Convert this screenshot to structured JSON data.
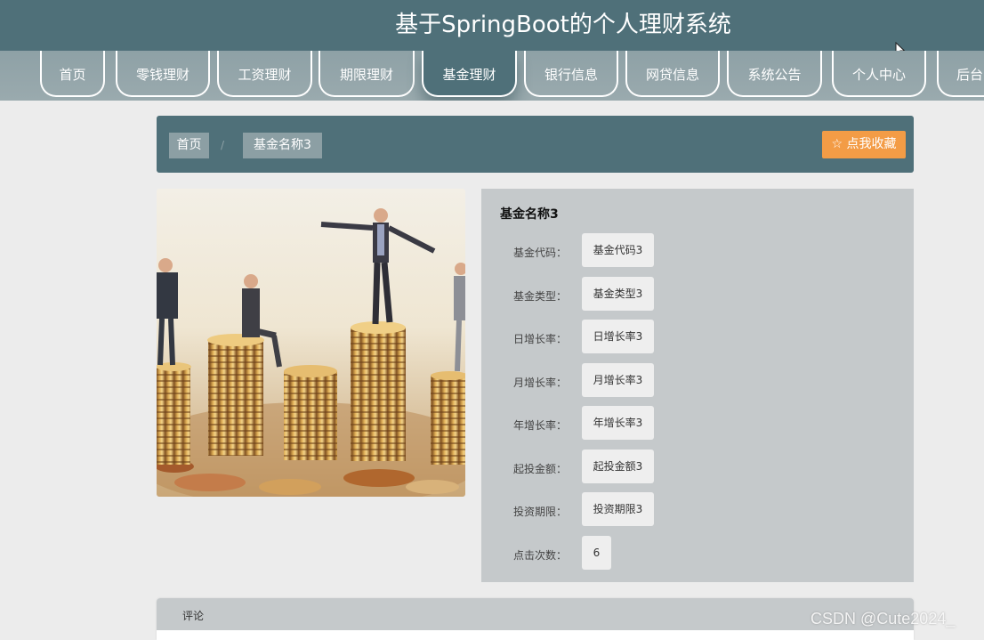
{
  "site": {
    "title": "基于SpringBoot的个人理财系统"
  },
  "nav": {
    "items": [
      {
        "label": "首页"
      },
      {
        "label": "零钱理财"
      },
      {
        "label": "工资理财"
      },
      {
        "label": "期限理财"
      },
      {
        "label": "基金理财",
        "active": true
      },
      {
        "label": "银行信息"
      },
      {
        "label": "网贷信息"
      },
      {
        "label": "系统公告"
      },
      {
        "label": "个人中心"
      },
      {
        "label": "后台"
      }
    ]
  },
  "breadcrumb": {
    "home": "首页",
    "separator": "/",
    "current": "基金名称3"
  },
  "favorite": {
    "label": "☆ 点我收藏"
  },
  "photo": {
    "icon": "fund-photo"
  },
  "details": {
    "title": "基金名称3",
    "rows": [
      {
        "label": "基金代码：",
        "value": "基金代码3"
      },
      {
        "label": "基金类型：",
        "value": "基金类型3"
      },
      {
        "label": "日增长率：",
        "value": "日增长率3"
      },
      {
        "label": "月增长率：",
        "value": "月增长率3"
      },
      {
        "label": "年增长率：",
        "value": "年增长率3"
      },
      {
        "label": "起投金额：",
        "value": "起投金额3"
      },
      {
        "label": "投资期限：",
        "value": "投资期限3"
      },
      {
        "label": "点击次数：",
        "value": "6"
      }
    ]
  },
  "comments": {
    "label": "评论"
  },
  "watermark": {
    "text": "CSDN @Cute2024_"
  },
  "colors": {
    "primary": "#4f7079",
    "nav": "#9aaaae",
    "accent": "#f39c46",
    "panel": "#c5c9cb",
    "background": "#ececec"
  }
}
